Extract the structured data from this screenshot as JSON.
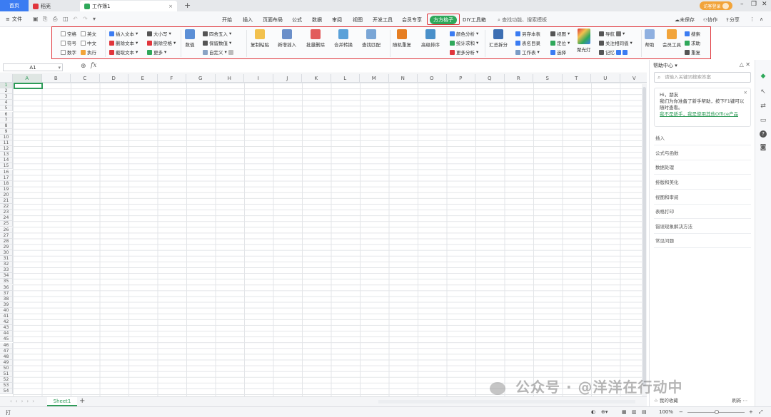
{
  "titlebar": {
    "tabs": [
      {
        "label": "首页"
      },
      {
        "label": "稻壳"
      },
      {
        "label": "工作簿1"
      }
    ],
    "login_label": "访客登录",
    "colors": {
      "home_tab": "#3b7cf2",
      "docer": "#e0353b",
      "sheet": "#2fa85a",
      "login": "#f2a43a"
    }
  },
  "menubar": {
    "file_label": "文件",
    "tabs": [
      "开始",
      "插入",
      "页面布局",
      "公式",
      "数据",
      "审阅",
      "视图",
      "开发工具",
      "会员专享",
      "方方格子",
      "DIY工具箱"
    ],
    "active_tab": "方方格子",
    "search_label": "查找功能、搜索模板",
    "unsaved_label": "未保存",
    "collab_label": "协作",
    "share_label": "分享"
  },
  "ribbon": {
    "checkboxes": [
      "空格",
      "英文",
      "符号",
      "中文",
      "数字"
    ],
    "exec_label": "执行",
    "text_ops": [
      "插入文本",
      "删除文本",
      "截取文本"
    ],
    "text_ops2": [
      "大小写",
      "删除空格",
      "更多"
    ],
    "numeric_label": "数值",
    "numeric_ops": [
      "四舍五入",
      "保留数值",
      "自定义"
    ],
    "big_buttons": [
      "复制粘贴",
      "新增插入",
      "批量删除",
      "合并转换",
      "查找匹配",
      "随机重复",
      "高级排序"
    ],
    "analysis_ops": [
      "颜色分析",
      "统计求和",
      "更多分析"
    ],
    "summary_label": "汇总拆分",
    "sheet_ops": [
      "另存本表",
      "表名目录",
      "工作表"
    ],
    "view_ops": [
      "视图",
      "定位",
      "选择"
    ],
    "spotlight_label": "聚光灯",
    "nav_ops": [
      "导航",
      "关注相同值",
      "记忆"
    ],
    "help_label": "帮助",
    "member_label": "会员工具",
    "extra_ops": [
      "搜索",
      "求助",
      "重复"
    ]
  },
  "formulabar": {
    "cell_ref": "A1",
    "fx_label": "fx"
  },
  "grid": {
    "columns": [
      "A",
      "B",
      "C",
      "D",
      "E",
      "F",
      "G",
      "H",
      "I",
      "J",
      "K",
      "L",
      "M",
      "N",
      "O",
      "P",
      "Q",
      "R",
      "S",
      "T",
      "U",
      "V"
    ],
    "rows": [
      "1",
      "2",
      "3",
      "4",
      "5",
      "6",
      "7",
      "8",
      "9",
      "10",
      "11",
      "12",
      "13",
      "14",
      "15",
      "16",
      "17",
      "18",
      "19",
      "20",
      "21",
      "22",
      "23",
      "24",
      "25",
      "26",
      "27",
      "28",
      "29",
      "30",
      "31",
      "32",
      "33",
      "34",
      "35",
      "36",
      "37",
      "38",
      "39",
      "40",
      "41",
      "42",
      "43",
      "44",
      "45",
      "46",
      "47",
      "48",
      "49",
      "50",
      "51",
      "52",
      "53",
      "54"
    ],
    "selected_cell": "A1"
  },
  "sheets": {
    "tabs": [
      "Sheet1"
    ],
    "active": "Sheet1"
  },
  "statusbar": {
    "left_icon": "打",
    "zoom_label": "100%"
  },
  "help_panel": {
    "title": "帮助中心",
    "search_placeholder": "请输入关键词搜索答案",
    "greeting": "Hi，朋友",
    "message": "我们为你准备了新手帮助，按下F1键可以随时查看。",
    "link": "我不是新手，我是使用其他Office产品",
    "categories": [
      "插入",
      "公式与函数",
      "数据处理",
      "排版和美化",
      "视图和审阅",
      "表格打印",
      "错误现象解决方法",
      "常见问题"
    ],
    "favorites_label": "我的收藏",
    "refresh_label": "刷新"
  },
  "watermark": "公众号 · @洋洋在行动中"
}
